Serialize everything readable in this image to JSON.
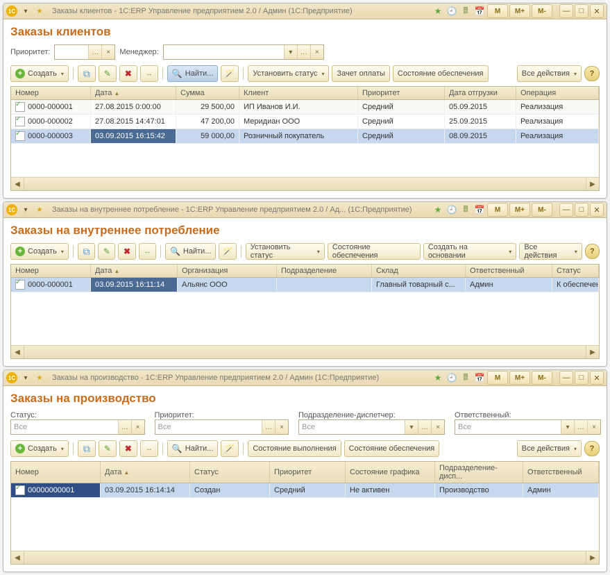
{
  "common": {
    "create": "Создать",
    "find": "Найти...",
    "set_status": "Установить статус",
    "supply_state": "Состояние обеспечения",
    "all_actions": "Все действия",
    "m": "M",
    "m_plus": "M+",
    "m_minus": "M-"
  },
  "win1": {
    "title": "Заказы клиентов - 1С:ERP Управление предприятием 2.0 / Админ  (1С:Предприятие)",
    "page_title": "Заказы клиентов",
    "priority_lbl": "Приоритет:",
    "manager_lbl": "Менеджер:",
    "credit_payment": "Зачет оплаты",
    "cols": {
      "num": "Номер",
      "date": "Дата",
      "sum": "Сумма",
      "client": "Клиент",
      "pri": "Приоритет",
      "ship": "Дата отгрузки",
      "op": "Операция"
    },
    "rows": [
      {
        "num": "0000-000001",
        "date": "27.08.2015 0:00:00",
        "sum": "29 500,00",
        "client": "ИП Иванов И.И.",
        "pri": "Средний",
        "ship": "05.09.2015",
        "op": "Реализация"
      },
      {
        "num": "0000-000002",
        "date": "27.08.2015 14:47:01",
        "sum": "47 200,00",
        "client": "Меридиан ООО",
        "pri": "Средний",
        "ship": "25.09.2015",
        "op": "Реализация"
      },
      {
        "num": "0000-000003",
        "date": "03.09.2015 16:15:42",
        "sum": "59 000,00",
        "client": "Розничный покупатель",
        "pri": "Средний",
        "ship": "08.09.2015",
        "op": "Реализация"
      }
    ]
  },
  "win2": {
    "title": "Заказы на внутреннее потребление - 1С:ERP Управление предприятием 2.0 / Ад...  (1С:Предприятие)",
    "page_title": "Заказы на внутреннее потребление",
    "create_based": "Создать на основании",
    "cols": {
      "num": "Номер",
      "date": "Дата",
      "org": "Организация",
      "dept": "Подразделение",
      "stor": "Склад",
      "resp": "Ответственный",
      "stat": "Статус"
    },
    "rows": [
      {
        "num": "0000-000001",
        "date": "03.09.2015 16:11:14",
        "org": "Альянс ООО",
        "dept": "",
        "stor": "Главный товарный с...",
        "resp": "Админ",
        "stat": "К обеспечению"
      }
    ]
  },
  "win3": {
    "title": "Заказы на производство - 1С:ERP Управление предприятием 2.0 / Админ  (1С:Предприятие)",
    "page_title": "Заказы на производство",
    "status_lbl": "Статус:",
    "priority_lbl": "Приоритет:",
    "dispatcher_lbl": "Подразделение-диспетчер:",
    "resp_lbl": "Ответственный:",
    "all": "Все",
    "exec_state": "Состояние выполнения",
    "cols": {
      "num": "Номер",
      "date": "Дата",
      "stat": "Статус",
      "pri": "Приоритет",
      "graf": "Состояние графика",
      "dept": "Подразделение-дисп...",
      "resp": "Ответственный"
    },
    "rows": [
      {
        "num": "00000000001",
        "date": "03.09.2015 16:14:14",
        "stat": "Создан",
        "pri": "Средний",
        "graf": "Не активен",
        "dept": "Производство",
        "resp": "Админ"
      }
    ]
  }
}
